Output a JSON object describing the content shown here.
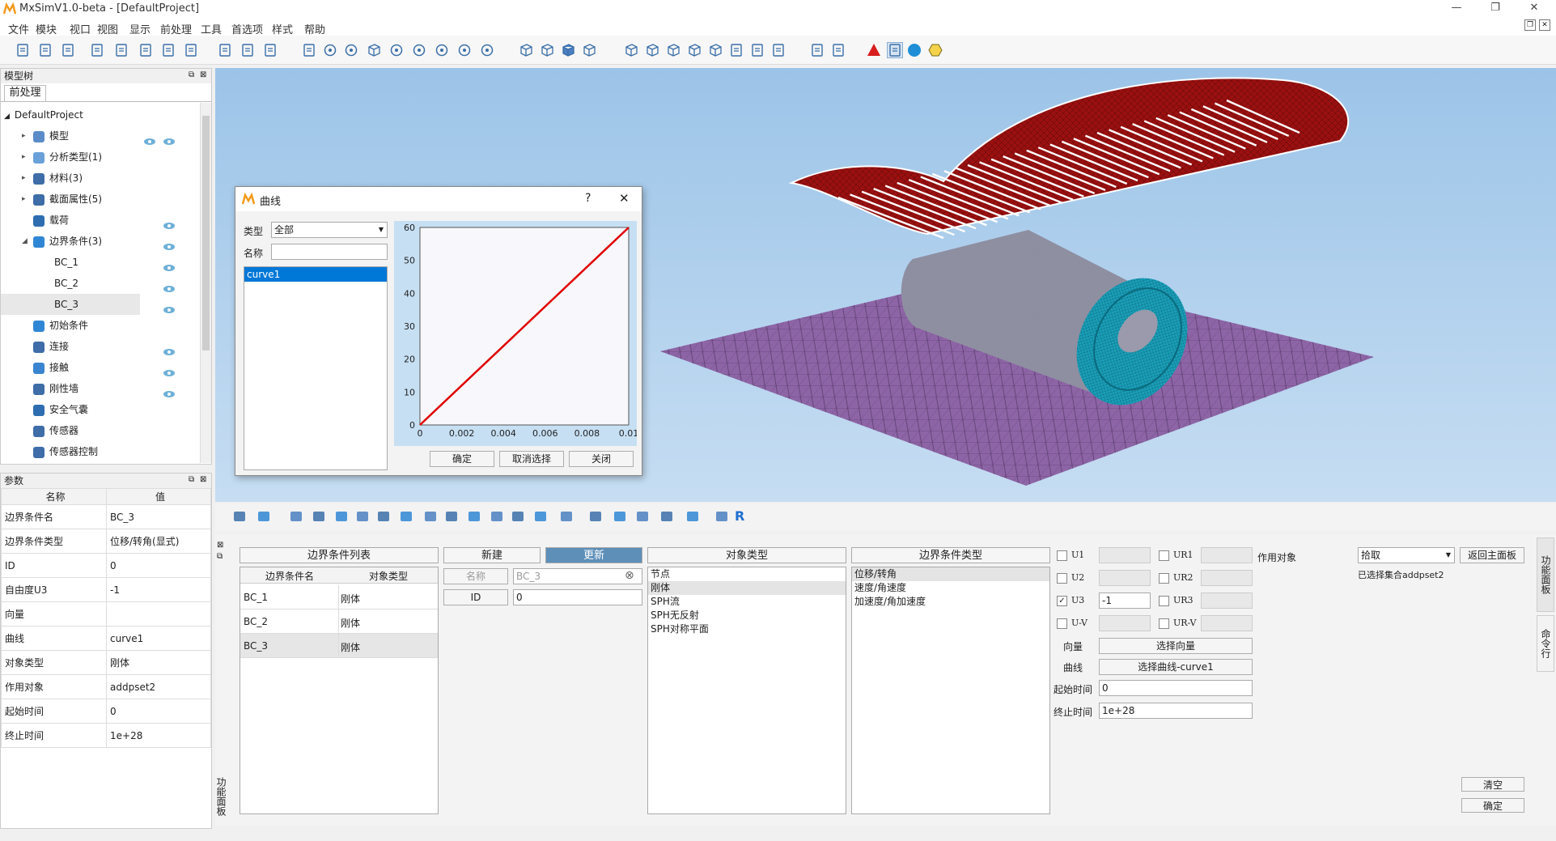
{
  "app": {
    "title": "MxSimV1.0-beta - [DefaultProject]"
  },
  "menu": [
    "文件",
    "模块",
    "视口",
    "视图",
    "显示",
    "前处理",
    "工具",
    "首选项",
    "样式",
    "帮助"
  ],
  "icons": [
    "new-file-icon",
    "open-file-icon",
    "save-icon",
    "export-icon",
    "import-icon",
    "mesh-icon",
    "screen-icon",
    "monitor-icon",
    "gear-icon",
    "frame-icon",
    "move-icon",
    "fit-icon",
    "rotate-icon",
    "rotate-x-icon",
    "cube-rotate-icon",
    "rotate-90-icon",
    "rotate-90b-icon",
    "reset-icon",
    "zoom-out-icon",
    "zoom-in-icon",
    "wire-cube-icon",
    "grid-cube-icon",
    "solid-cube-icon",
    "mesh-cube-icon",
    "view-front-icon",
    "view-back-icon",
    "view-left-icon",
    "view-right-icon",
    "view-top-icon",
    "axis-icon",
    "axis2-icon",
    "axis3-icon",
    "layout-icon",
    "windows-icon",
    "warning-icon",
    "select-node-icon",
    "sphere-icon",
    "hexagon-icon"
  ],
  "tree": {
    "dock_title": "模型树",
    "tab": "前处理",
    "root": "DefaultProject",
    "items": [
      {
        "label": "模型",
        "eye": true
      },
      {
        "label": "分析类型(1)",
        "eye": false
      },
      {
        "label": "材料(3)",
        "eye": false
      },
      {
        "label": "截面属性(5)",
        "eye": false
      },
      {
        "label": "载荷",
        "eye": true
      },
      {
        "label": "边界条件(3)",
        "eye": true
      },
      {
        "label": "BC_1",
        "eye": true
      },
      {
        "label": "BC_2",
        "eye": true
      },
      {
        "label": "BC_3",
        "eye": true
      },
      {
        "label": "初始条件",
        "eye": false
      },
      {
        "label": "连接",
        "eye": true
      },
      {
        "label": "接触",
        "eye": true
      },
      {
        "label": "刚性墙",
        "eye": true
      },
      {
        "label": "安全气囊",
        "eye": false
      },
      {
        "label": "传感器",
        "eye": false
      },
      {
        "label": "传感器控制",
        "eye": false
      }
    ]
  },
  "params": {
    "dock_title": "参数",
    "head_name": "名称",
    "head_value": "值",
    "rows": [
      {
        "k": "边界条件名",
        "v": "BC_3"
      },
      {
        "k": "边界条件类型",
        "v": "位移/转角(显式)"
      },
      {
        "k": "ID",
        "v": "0"
      },
      {
        "k": "自由度U3",
        "v": "-1"
      },
      {
        "k": "向量",
        "v": ""
      },
      {
        "k": "曲线",
        "v": "curve1"
      },
      {
        "k": "对象类型",
        "v": "刚体"
      },
      {
        "k": "作用对象",
        "v": "addpset2"
      },
      {
        "k": "起始时间",
        "v": "0"
      },
      {
        "k": "终止时间",
        "v": "1e+28"
      }
    ]
  },
  "dialog": {
    "title": "曲线",
    "help": "?",
    "close": "✕",
    "type_label": "类型",
    "type_value": "全部",
    "name_label": "名称",
    "name_value": "",
    "list": [
      "curve1"
    ],
    "ok": "确定",
    "deselect": "取消选择",
    "close_btn": "关闭"
  },
  "chart_data": {
    "type": "line",
    "xlim": [
      0,
      0.01
    ],
    "ylim": [
      0,
      60
    ],
    "x_ticks": [
      "0",
      "0.002",
      "0.004",
      "0.006",
      "0.008",
      "0.01"
    ],
    "y_ticks": [
      "0",
      "10",
      "20",
      "30",
      "40",
      "50",
      "60"
    ],
    "series": [
      {
        "x": [
          0,
          0.01
        ],
        "y": [
          0,
          60
        ],
        "color": "#e00000"
      }
    ]
  },
  "func": {
    "list_header": "边界条件列表",
    "col_name": "边界条件名",
    "col_type": "对象类型",
    "rows": [
      {
        "name": "BC_1",
        "type": "刚体"
      },
      {
        "name": "BC_2",
        "type": "刚体"
      },
      {
        "name": "BC_3",
        "type": "刚体"
      }
    ],
    "new_btn": "新建",
    "update_btn": "更新",
    "name_label": "名称",
    "name_placeholder": "BC_3",
    "id_label": "ID",
    "id_value": "0",
    "obj_type_header": "对象类型",
    "obj_types": [
      "节点",
      "刚体",
      "SPH流",
      "SPH无反射",
      "SPH对称平面"
    ],
    "bc_type_header": "边界条件类型",
    "bc_types": [
      "位移/转角",
      "速度/角速度",
      "加速度/角加速度"
    ],
    "dofs_left": [
      {
        "label": "U1",
        "checked": false,
        "value": ""
      },
      {
        "label": "U2",
        "checked": false,
        "value": ""
      },
      {
        "label": "U3",
        "checked": true,
        "value": "-1"
      },
      {
        "label": "U-V",
        "checked": false,
        "value": ""
      }
    ],
    "dofs_right": [
      {
        "label": "UR1",
        "checked": false
      },
      {
        "label": "UR2",
        "checked": false
      },
      {
        "label": "UR3",
        "checked": false
      },
      {
        "label": "UR-V",
        "checked": false
      }
    ],
    "target_label": "作用对象",
    "vector_label": "向量",
    "vector_btn": "选择向量",
    "curve_label": "曲线",
    "curve_btn": "选择曲线-curve1",
    "start_label": "起始时间",
    "start_value": "0",
    "end_label": "终止时间",
    "end_value": "1e+28",
    "pick_value": "拾取",
    "return_btn": "返回主面板",
    "selected_text": "已选择集合addpset2",
    "clear_btn": "清空",
    "confirm_btn": "确定",
    "side_tab1": "功能面板",
    "side_tab2": "命令行",
    "left_vtab": "功能面板"
  }
}
